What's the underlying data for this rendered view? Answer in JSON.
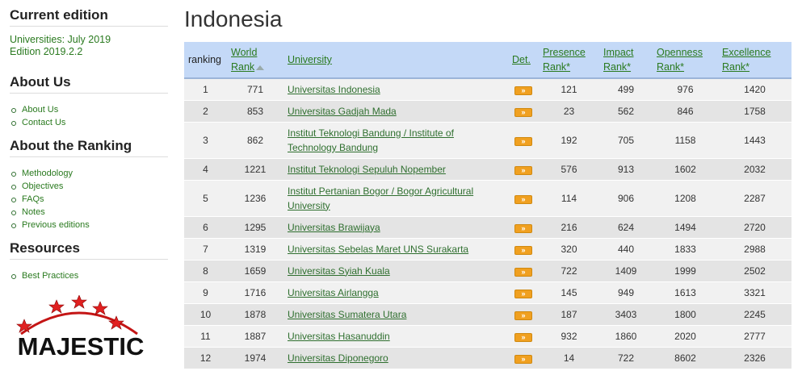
{
  "sidebar": {
    "current_heading": "Current edition",
    "edition_line1": "Universities: July 2019",
    "edition_line2": "Edition 2019.2.2",
    "about_us": {
      "heading": "About Us",
      "items": [
        "About Us",
        "Contact Us"
      ]
    },
    "about_ranking": {
      "heading": "About the Ranking",
      "items": [
        "Methodology",
        "Objectives",
        "FAQs",
        "Notes",
        "Previous editions"
      ]
    },
    "resources": {
      "heading": "Resources",
      "items": [
        "Best Practices"
      ]
    },
    "logo_text": "MAJESTIC"
  },
  "main": {
    "title": "Indonesia",
    "headers": {
      "ranking": "ranking",
      "world_rank": "World Rank",
      "university": "University",
      "det": "Det.",
      "presence": "Presence Rank*",
      "impact": "Impact Rank*",
      "openness": "Openness Rank*",
      "excellence": "Excellence Rank*"
    },
    "det_glyph": "»",
    "rows": [
      {
        "ranking": "1",
        "world": "771",
        "uni": "Universitas Indonesia",
        "presence": "121",
        "impact": "499",
        "openness": "976",
        "excellence": "1420"
      },
      {
        "ranking": "2",
        "world": "853",
        "uni": "Universitas Gadjah Mada",
        "presence": "23",
        "impact": "562",
        "openness": "846",
        "excellence": "1758"
      },
      {
        "ranking": "3",
        "world": "862",
        "uni": "Institut Teknologi Bandung / Institute of Technology Bandung",
        "presence": "192",
        "impact": "705",
        "openness": "1158",
        "excellence": "1443"
      },
      {
        "ranking": "4",
        "world": "1221",
        "uni": "Institut Teknologi Sepuluh Nopember",
        "presence": "576",
        "impact": "913",
        "openness": "1602",
        "excellence": "2032"
      },
      {
        "ranking": "5",
        "world": "1236",
        "uni": "Institut Pertanian Bogor / Bogor Agricultural University",
        "presence": "114",
        "impact": "906",
        "openness": "1208",
        "excellence": "2287"
      },
      {
        "ranking": "6",
        "world": "1295",
        "uni": "Universitas Brawijaya",
        "presence": "216",
        "impact": "624",
        "openness": "1494",
        "excellence": "2720"
      },
      {
        "ranking": "7",
        "world": "1319",
        "uni": "Universitas Sebelas Maret UNS Surakarta",
        "presence": "320",
        "impact": "440",
        "openness": "1833",
        "excellence": "2988"
      },
      {
        "ranking": "8",
        "world": "1659",
        "uni": "Universitas Syiah Kuala",
        "presence": "722",
        "impact": "1409",
        "openness": "1999",
        "excellence": "2502"
      },
      {
        "ranking": "9",
        "world": "1716",
        "uni": "Universitas Airlangga",
        "presence": "145",
        "impact": "949",
        "openness": "1613",
        "excellence": "3321"
      },
      {
        "ranking": "10",
        "world": "1878",
        "uni": "Universitas Sumatera Utara",
        "presence": "187",
        "impact": "3403",
        "openness": "1800",
        "excellence": "2245"
      },
      {
        "ranking": "11",
        "world": "1887",
        "uni": "Universitas Hasanuddin",
        "presence": "932",
        "impact": "1860",
        "openness": "2020",
        "excellence": "2777"
      },
      {
        "ranking": "12",
        "world": "1974",
        "uni": "Universitas Diponegoro",
        "presence": "14",
        "impact": "722",
        "openness": "8602",
        "excellence": "2326"
      }
    ]
  },
  "colors": {
    "link_green": "#2a7a1f",
    "header_blue": "#c4d9f7",
    "det_orange": "#f0a020",
    "star_red": "#e02020"
  }
}
